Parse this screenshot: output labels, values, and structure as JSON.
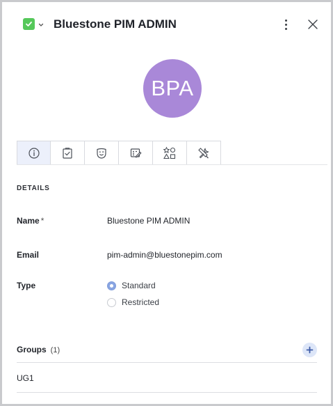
{
  "header": {
    "title": "Bluestone PIM ADMIN",
    "status_color": "#55c85a"
  },
  "avatar": {
    "initials": "BPA",
    "color": "#a988d8"
  },
  "tabs": [
    {
      "icon": "info-icon",
      "active": true
    },
    {
      "icon": "clipboard-check-icon",
      "active": false
    },
    {
      "icon": "smiley-icon",
      "active": false
    },
    {
      "icon": "grid-edit-icon",
      "active": false
    },
    {
      "icon": "shapes-icon",
      "active": false
    },
    {
      "icon": "tools-icon",
      "active": false
    }
  ],
  "details": {
    "section_title": "DETAILS",
    "name_label": "Name",
    "required_mark": "*",
    "name_value": "Bluestone PIM ADMIN",
    "email_label": "Email",
    "email_value": "pim-admin@bluestonepim.com",
    "type_label": "Type",
    "type_options": [
      "Standard",
      "Restricted"
    ],
    "type_selected": "Standard"
  },
  "groups": {
    "label": "Groups",
    "count": "(1)",
    "items": [
      "UG1"
    ]
  }
}
